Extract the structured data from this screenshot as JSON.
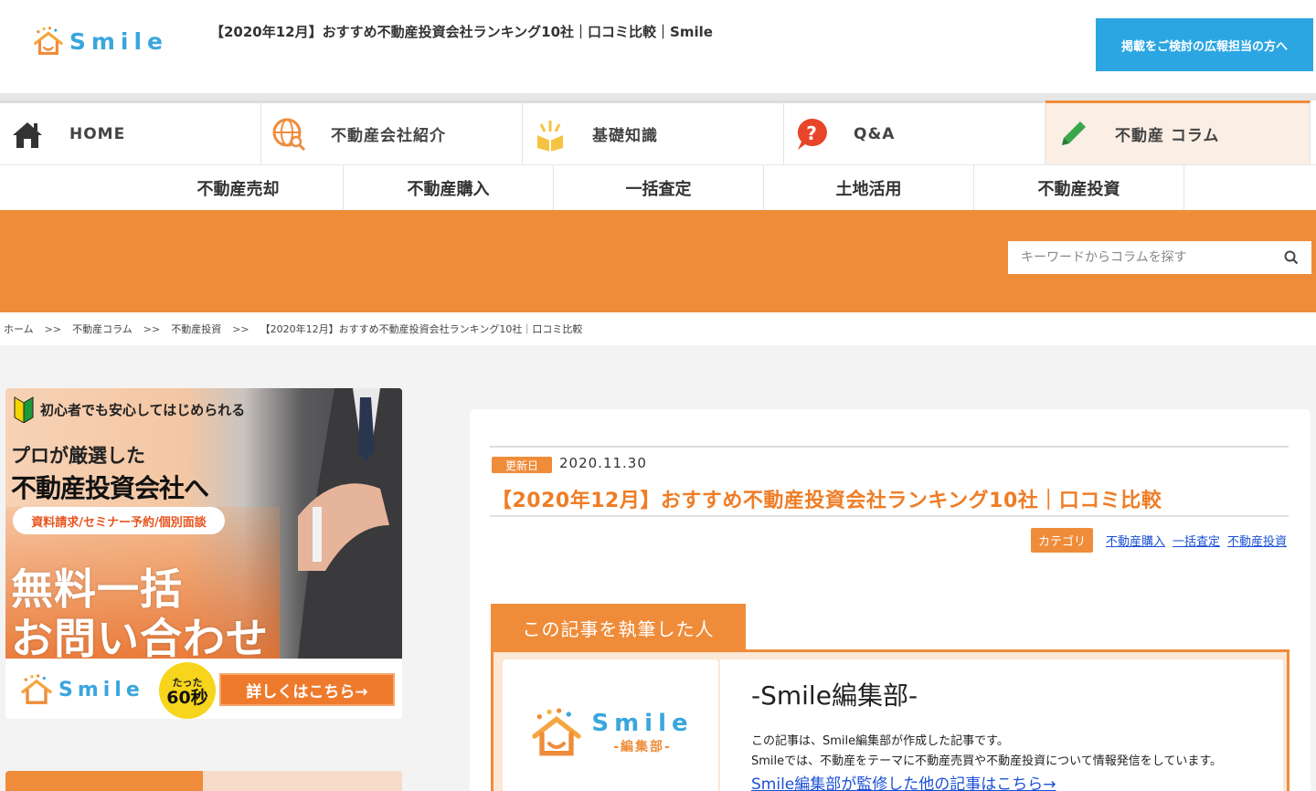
{
  "header": {
    "logo_text": "Smile",
    "site_title": "【2020年12月】おすすめ不動産投資会社ランキング10社｜口コミ比較｜Smile",
    "ad_button": "掲載をご検討の広報担当の方へ"
  },
  "main_nav": [
    {
      "label": "HOME",
      "icon": "home-icon"
    },
    {
      "label": "不動産会社紹介",
      "icon": "globe-search-icon"
    },
    {
      "label": "基礎知識",
      "icon": "book-idea-icon"
    },
    {
      "label": "Q&A",
      "icon": "question-bubble-icon"
    },
    {
      "label": "不動産 コラム",
      "icon": "pencil-icon"
    }
  ],
  "sub_nav": [
    "不動産売却",
    "不動産購入",
    "一括査定",
    "土地活用",
    "不動産投資"
  ],
  "search": {
    "placeholder": "キーワードからコラムを探す"
  },
  "breadcrumb": [
    "ホーム",
    "不動産コラム",
    "不動産投資",
    "【2020年12月】おすすめ不動産投資会社ランキング10社｜口コミ比較"
  ],
  "breadcrumb_sep": ">>",
  "promo": {
    "tag_line": "初心者でも安心してはじめられる",
    "line1": "プロが厳選した",
    "line2": "不動産投資会社へ",
    "pill": "資料請求/セミナー予約/個別面談",
    "big1": "無料一括",
    "big2": "お問い合わせ",
    "logo_text": "Smile",
    "badge_small": "たった",
    "badge_big": "60秒",
    "cta": "詳しくはこちら→"
  },
  "article": {
    "update_label": "更新日",
    "update_date": "2020.11.30",
    "title": "【2020年12月】おすすめ不動産投資会社ランキング10社｜口コミ比較",
    "category_label": "カテゴリ",
    "categories": [
      "不動産購入",
      "一括査定",
      "不動産投資"
    ]
  },
  "author": {
    "tab_label": "この記事を執筆した人",
    "logo_text": "Smile",
    "logo_sub": "-編集部-",
    "name": "-Smile編集部-",
    "desc1": "この記事は、Smile編集部が作成した記事です。",
    "desc2": "Smileでは、不動産をテーマに不動産売買や不動産投資について情報発信をしています。",
    "link": "Smile編集部が監修した他の記事はこちら→"
  },
  "colors": {
    "accent": "#ef8c3a",
    "brand_blue": "#3aa6dd",
    "link": "#1a4fd6"
  }
}
